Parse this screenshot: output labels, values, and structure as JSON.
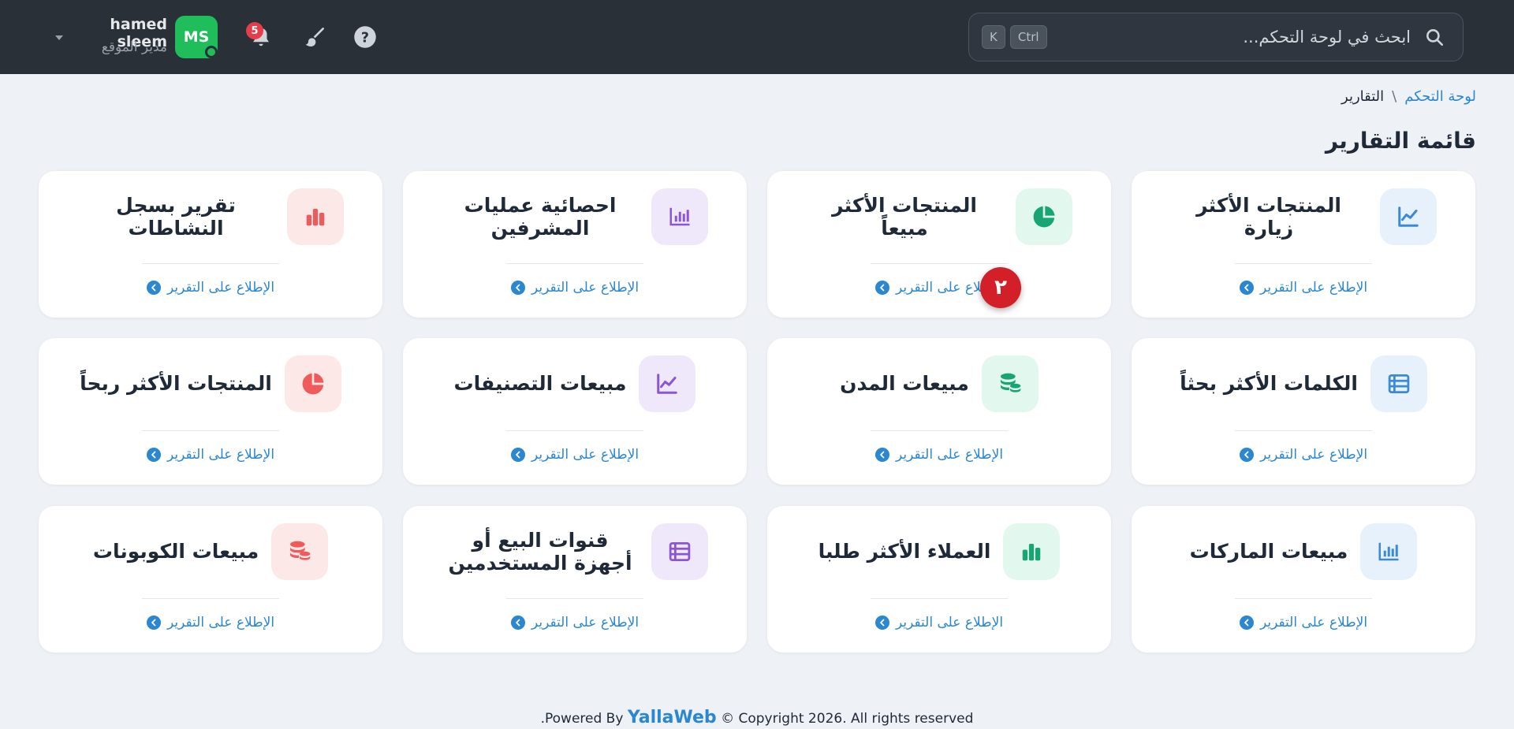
{
  "header": {
    "search_placeholder": "ابحث في لوحة التحكم...",
    "kbd_ctrl": "Ctrl",
    "kbd_k": "K",
    "notification_count": "5",
    "user": {
      "initials": "MS",
      "name": "hamed sleem",
      "role": "مدير الموقع"
    }
  },
  "breadcrumb": {
    "home": "لوحة التحكم",
    "separator": "\\",
    "current": "التقارير"
  },
  "page_title": "قائمة التقارير",
  "link_label": "الإطلاع على التقرير",
  "cards": [
    {
      "title": "المنتجات الأكثر زيارة",
      "icon": "line-chart-icon",
      "tint": "#e6f1fc",
      "color": "#3a8ad6"
    },
    {
      "title": "المنتجات الأكثر مبيعاً",
      "icon": "pie-chart-icon",
      "tint": "#e2f7ee",
      "color": "#17a673"
    },
    {
      "title": "احصائية عمليات المشرفين",
      "icon": "bar-chart-icon",
      "tint": "#efe8fb",
      "color": "#8b55d6"
    },
    {
      "title": "تقرير بسجل النشاطات",
      "icon": "column-chart-icon",
      "tint": "#fde8e8",
      "color": "#ef5b5b"
    },
    {
      "title": "الكلمات الأكثر بحثاً",
      "icon": "list-icon",
      "tint": "#e6f1fc",
      "color": "#3a8ad6"
    },
    {
      "title": "مبيعات المدن",
      "icon": "coins-icon",
      "tint": "#e2f7ee",
      "color": "#17a673"
    },
    {
      "title": "مبيعات التصنيفات",
      "icon": "line-chart-icon",
      "tint": "#efe8fb",
      "color": "#8b55d6"
    },
    {
      "title": "المنتجات الأكثر ربحاً",
      "icon": "pie-chart-icon",
      "tint": "#fde8e8",
      "color": "#ef5b5b"
    },
    {
      "title": "مبيعات الماركات",
      "icon": "bar-chart-icon",
      "tint": "#e6f1fc",
      "color": "#3a8ad6"
    },
    {
      "title": "العملاء الأكثر طلبا",
      "icon": "column-chart-icon",
      "tint": "#e2f7ee",
      "color": "#17a673"
    },
    {
      "title": "قنوات البيع أو أجهزة المستخدمين",
      "icon": "list-icon",
      "tint": "#efe8fb",
      "color": "#8b55d6"
    },
    {
      "title": "مبيعات الكوبونات",
      "icon": "coins-icon",
      "tint": "#fde8e8",
      "color": "#ef5b5b"
    }
  ],
  "step_marker": "٢",
  "footer": {
    "prefix": ".Powered By",
    "brand": "YallaWeb",
    "suffix": "© Copyright 2026. All rights reserved"
  }
}
